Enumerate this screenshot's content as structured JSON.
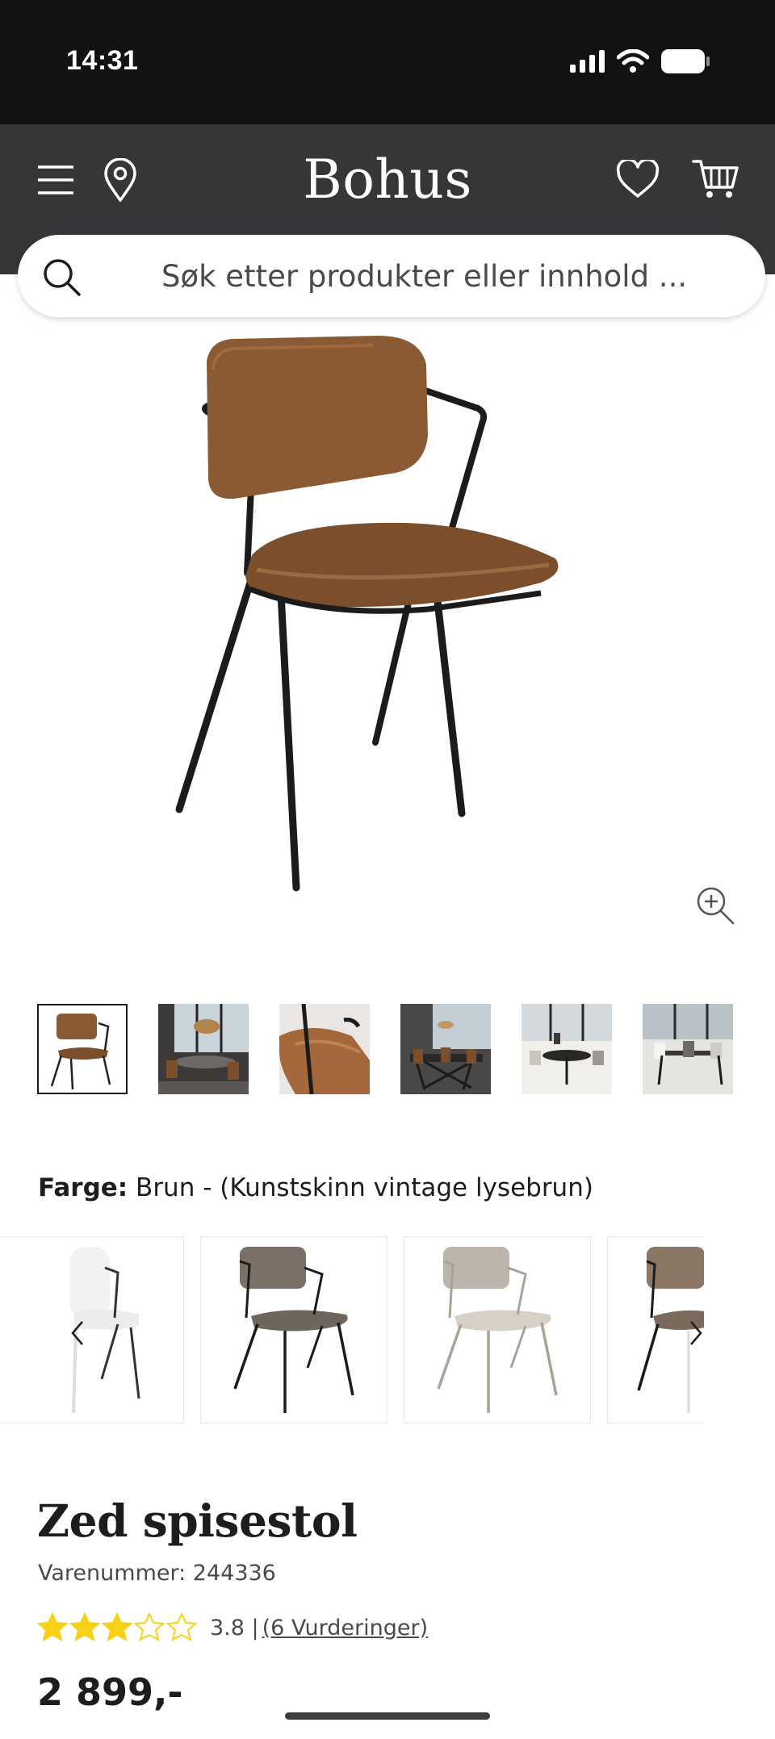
{
  "status_bar": {
    "time": "14:31"
  },
  "header": {
    "brand": "Bohus"
  },
  "search": {
    "placeholder": "Søk etter produkter eller innhold ..."
  },
  "color": {
    "label": "Farge:",
    "value": "Brun - (Kunstskinn vintage lysebrun)"
  },
  "product": {
    "title": "Zed spisestol",
    "sku": "Varenummer: 244336",
    "rating_value": "3.8 |",
    "reviews_link": "(6 Vurderinger)",
    "rating_fraction": 0.76,
    "price": "2 899,-"
  },
  "colors": {
    "accent": "#f7d117",
    "header_bg": "#363538",
    "status_bg": "#121114",
    "gallery_bg": "#f5f4f2",
    "seat_brown": "#8a5a34"
  }
}
